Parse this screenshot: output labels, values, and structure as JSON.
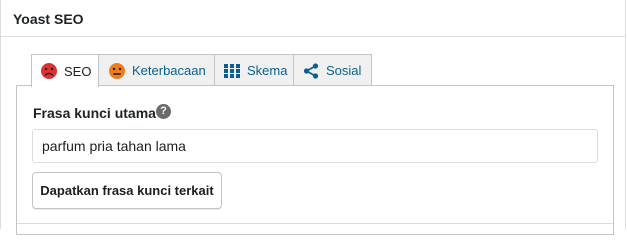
{
  "metabox": {
    "title": "Yoast SEO"
  },
  "tabs": [
    {
      "label": "SEO",
      "icon": "sad-face-icon",
      "color": "#dc3232",
      "active": true
    },
    {
      "label": "Keterbacaan",
      "icon": "neutral-face-icon",
      "color": "#ee7c1b",
      "active": false
    },
    {
      "label": "Skema",
      "icon": "grid-icon",
      "color": "#0a5f8f",
      "active": false
    },
    {
      "label": "Sosial",
      "icon": "share-icon",
      "color": "#0a5f8f",
      "active": false
    }
  ],
  "seo": {
    "keyphrase_label": "Frasa kunci utama",
    "help_icon": "?",
    "keyphrase_value": "parfum pria tahan lama",
    "related_button": "Dapatkan frasa kunci terkait"
  }
}
